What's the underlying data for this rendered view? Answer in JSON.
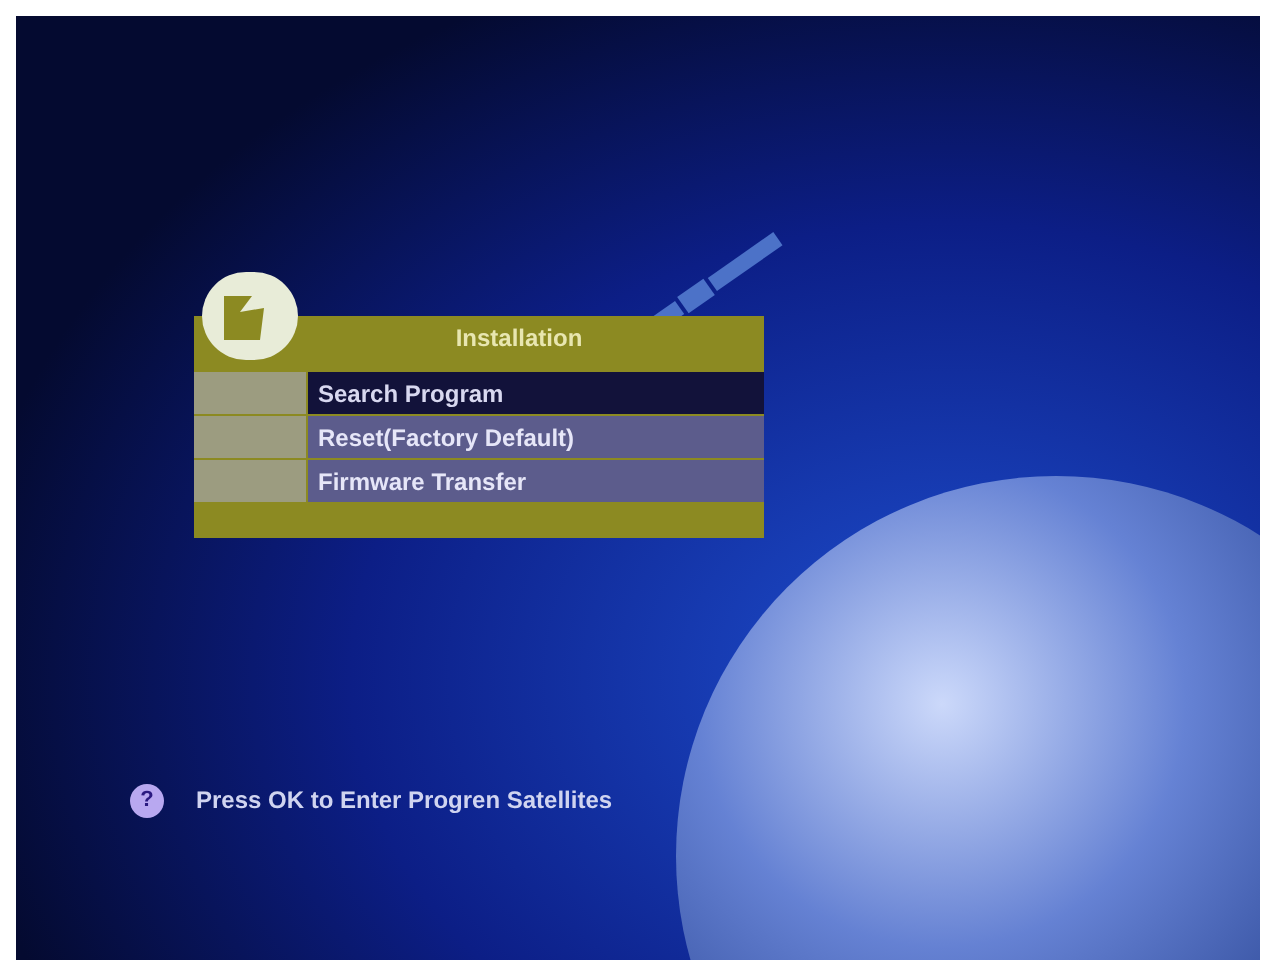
{
  "menu": {
    "title": "Installation",
    "items": [
      {
        "label": "Search Program",
        "selected": true
      },
      {
        "label": "Reset(Factory Default)",
        "selected": false
      },
      {
        "label": "Firmware Transfer",
        "selected": false
      }
    ]
  },
  "help": {
    "icon": "?",
    "text": "Press OK to Enter Progren Satellites"
  }
}
